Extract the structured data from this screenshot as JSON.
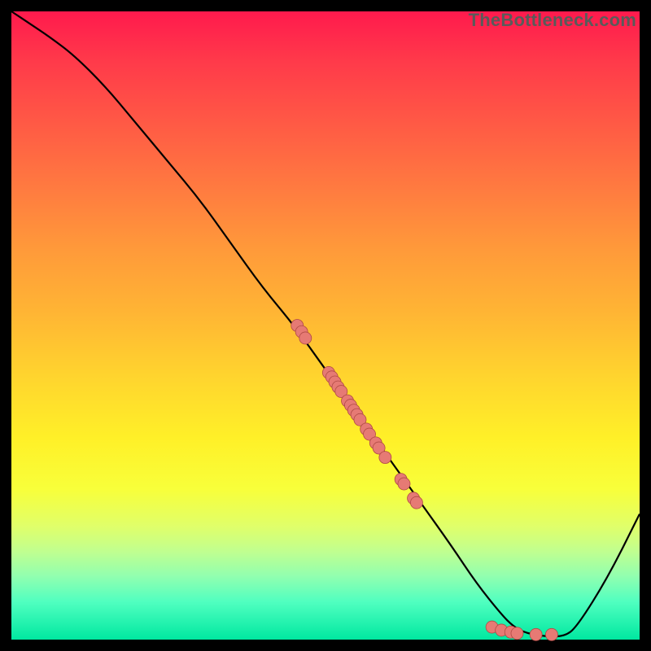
{
  "attribution": "TheBottleneck.com",
  "colors": {
    "dot_fill": "#e67a74",
    "dot_stroke": "#b04a44",
    "curve": "#000000"
  },
  "chart_data": {
    "type": "line",
    "title": "",
    "xlabel": "",
    "ylabel": "",
    "xlim": [
      0,
      100
    ],
    "ylim": [
      0,
      100
    ],
    "grid": false,
    "legend": false,
    "series": [
      {
        "name": "curve",
        "x": [
          0,
          3,
          6,
          10,
          15,
          20,
          25,
          30,
          35,
          40,
          45,
          50,
          55,
          60,
          65,
          70,
          74,
          78,
          80,
          82,
          85,
          88,
          90,
          95,
          100
        ],
        "y": [
          100,
          98,
          96,
          93,
          88,
          82,
          76,
          70,
          63,
          56,
          50,
          43,
          36,
          29,
          22,
          15,
          9,
          4,
          2,
          1,
          0.5,
          0.5,
          2,
          10,
          20
        ]
      }
    ],
    "scatter_points": [
      {
        "x": 45.5,
        "y": 50.0
      },
      {
        "x": 46.2,
        "y": 49.0
      },
      {
        "x": 46.8,
        "y": 48.0
      },
      {
        "x": 50.5,
        "y": 42.5
      },
      {
        "x": 51.0,
        "y": 41.8
      },
      {
        "x": 51.5,
        "y": 41.0
      },
      {
        "x": 52.0,
        "y": 40.2
      },
      {
        "x": 52.5,
        "y": 39.5
      },
      {
        "x": 53.5,
        "y": 38.0
      },
      {
        "x": 54.0,
        "y": 37.3
      },
      {
        "x": 54.5,
        "y": 36.5
      },
      {
        "x": 55.0,
        "y": 35.8
      },
      {
        "x": 55.5,
        "y": 35.0
      },
      {
        "x": 56.5,
        "y": 33.5
      },
      {
        "x": 57.0,
        "y": 32.7
      },
      {
        "x": 58.0,
        "y": 31.3
      },
      {
        "x": 58.5,
        "y": 30.5
      },
      {
        "x": 59.5,
        "y": 29.0
      },
      {
        "x": 62.0,
        "y": 25.5
      },
      {
        "x": 62.5,
        "y": 24.8
      },
      {
        "x": 64.0,
        "y": 22.5
      },
      {
        "x": 64.5,
        "y": 21.8
      },
      {
        "x": 76.5,
        "y": 2.0
      },
      {
        "x": 78.0,
        "y": 1.5
      },
      {
        "x": 79.5,
        "y": 1.2
      },
      {
        "x": 80.5,
        "y": 1.0
      },
      {
        "x": 83.5,
        "y": 0.8
      },
      {
        "x": 86.0,
        "y": 0.8
      }
    ]
  }
}
